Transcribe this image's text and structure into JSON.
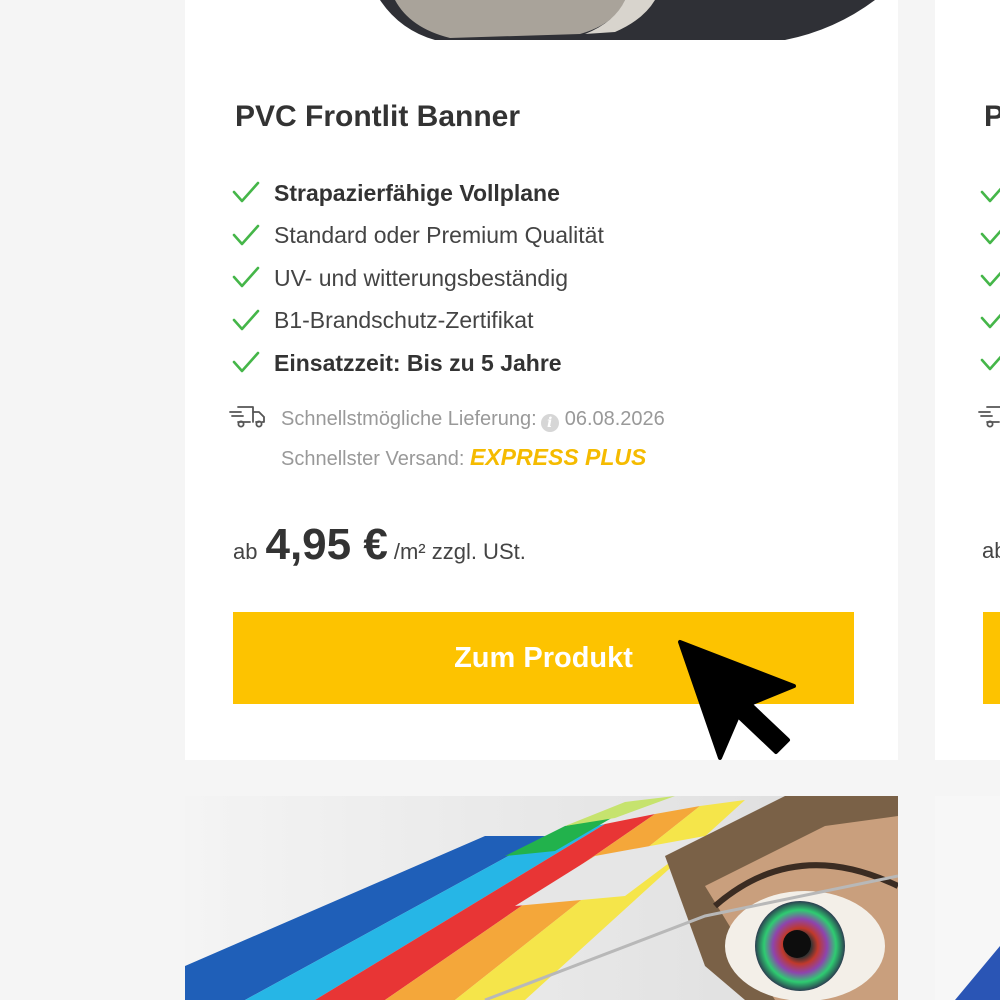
{
  "product": {
    "title": "PVC Frontlit Banner",
    "features": [
      {
        "text": "Strapazierfähige Vollplane",
        "bold": true
      },
      {
        "text": "Standard oder Premium Qualität",
        "bold": false
      },
      {
        "text": "UV- und witterungsbeständig",
        "bold": false
      },
      {
        "text": "B1-Brandschutz-Zertifikat",
        "bold": false
      },
      {
        "text": "Einsatzzeit: Bis zu 5 Jahre",
        "bold": true
      }
    ],
    "delivery": {
      "label": "Schnellstmögliche Lieferung:",
      "info_icon": "i",
      "date": "06.08.2026",
      "shipping_label": "Schnellster Versand:",
      "shipping_value": "EXPRESS PLUS"
    },
    "price": {
      "prefix": "ab",
      "value": "4,95 €",
      "unit": "/m² zzgl. USt."
    },
    "cta_label": "Zum Produkt"
  },
  "next_card": {
    "title_fragment": "P",
    "price_fragment": "ab"
  },
  "icons": {
    "check": "check-icon",
    "truck": "delivery-truck-icon",
    "info": "info-icon",
    "cursor": "mouse-cursor"
  },
  "colors": {
    "accent_yellow": "#fdc300",
    "express_yellow": "#f5bb00",
    "check_green": "#45b649",
    "muted_text": "#999999",
    "page_bg": "#f5f5f5"
  }
}
